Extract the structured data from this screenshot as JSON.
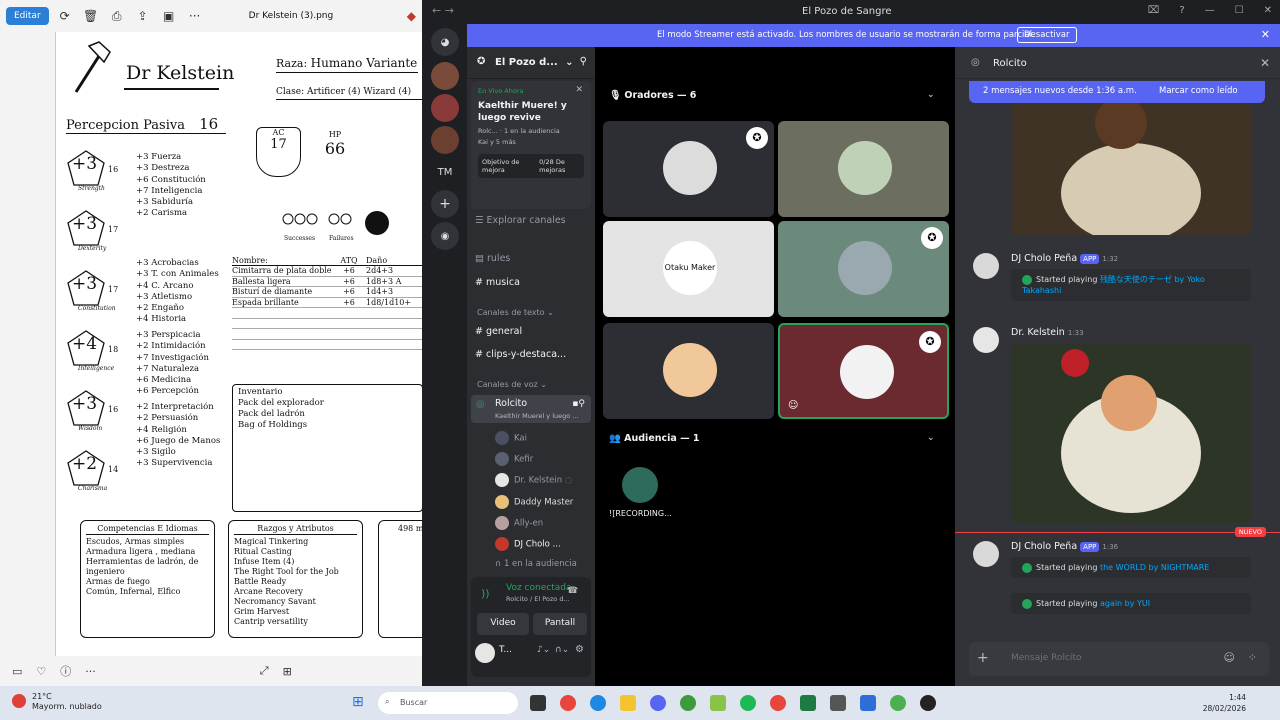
{
  "photo_viewer": {
    "edit_label": "Editar",
    "title": "Dr Kelstein (3).png"
  },
  "sheet": {
    "name": "Dr Kelstein",
    "race_label": "Raza:",
    "race": "Humano Variante",
    "class_label": "Clase:",
    "class": "Artificer (4) Wizard (4)",
    "perception_label": "Percepcion Pasiva",
    "perception": "16",
    "ac_label": "AC",
    "ac": "17",
    "hp_label": "HP",
    "hp": "66",
    "successes": "Successes",
    "failures": "Failures",
    "stats": [
      {
        "mod": "+3",
        "score": "16",
        "label": "Strength"
      },
      {
        "mod": "+3",
        "score": "17",
        "label": "Dexterity"
      },
      {
        "mod": "+3",
        "score": "17",
        "label": "Constitution"
      },
      {
        "mod": "+4",
        "score": "18",
        "label": "Intelligence"
      },
      {
        "mod": "+3",
        "score": "16",
        "label": "Wisdom"
      },
      {
        "mod": "+2",
        "score": "14",
        "label": "Charisma"
      }
    ],
    "saves": [
      "+3 Fuerza",
      "+3 Destreza",
      "+6 Constitución",
      "+7 Inteligencia",
      "+3 Sabiduría",
      "+2 Carisma"
    ],
    "skills_a": [
      "+3 Acrobacias",
      "+3 T. con Animales",
      "+4 C. Arcano",
      "+3 Atletismo",
      "+2 Engaño",
      "+4 Historia"
    ],
    "skills_b": [
      "+3 Perspicacia",
      "+2 Intimidación",
      "+7 Investigación",
      "+7 Naturaleza",
      "+6 Medicina",
      "+6 Percepción"
    ],
    "skills_c": [
      "+2 Interpretación",
      "+2 Persuasión",
      "+4 Religión",
      "+6 Juego de Manos",
      "+3 Sigilo",
      "+3 Supervivencia"
    ],
    "weapons_header": [
      "Nombre:",
      "ATQ",
      "Daño"
    ],
    "weapons": [
      [
        "Cimitarra de plata doble filo",
        "+6",
        "2d4+3"
      ],
      [
        "Ballesta ligera",
        "+6",
        "1d8+3 A"
      ],
      [
        "Bisturí de diamante",
        "+6",
        "1d4+3"
      ],
      [
        "Espada brillante",
        "+6",
        "1d8/1d10+"
      ]
    ],
    "inventory": [
      "Inventario",
      "Pack del explorador",
      "Pack del ladrón",
      "Bag of Holdings"
    ],
    "prof_title": "Competencias E Idiomas",
    "prof": [
      "Escudos, Armas simples",
      "Armadura ligera , mediana",
      "Herramientas de ladrón, de ingeniero",
      "Armas de fuego",
      "Común, Infernal, Elfico"
    ],
    "traits_title": "Razgos y Atributos",
    "traits": [
      "Magical Tinkering",
      "Ritual Casting",
      "Infuse Item (4)",
      "The Right Tool for the Job",
      "Battle Ready",
      "Arcane Recovery",
      "Necromancy Savant",
      "Grim Harvest",
      "Cantrip versatility"
    ],
    "right_box": "498 m"
  },
  "discord": {
    "window_title": "El Pozo de Sangre",
    "banner_text": "El modo Streamer está activado. Los nombres de usuario se mostrarán de forma parcial.",
    "banner_button": "Desactivar",
    "guild_tm": "TM",
    "server_name": "El Pozo d...",
    "live": {
      "status": "En Vivo Ahora",
      "title": "Kaelthir Muere! y luego revive",
      "meta1": "Rolc...  ·  1 en la audiencia",
      "meta2": "Kai y 5 más",
      "goal_label": "Objetivo de mejora",
      "goal_value": "0/28 De mejoras"
    },
    "explore": "Explorar canales",
    "channels": {
      "rules": "rules",
      "musica": "musica",
      "text_cat": "Canales de texto",
      "general": "general",
      "clips": "clips-y-destaca...",
      "voice_cat": "Canales de voz",
      "voice_channel": "Rolcito",
      "voice_sub": "Kaelthir Muerel y luego ..."
    },
    "voice_users": [
      "Kai",
      "Kefir",
      "Dr. Kelstein",
      "Daddy Master",
      "Ally-en",
      "DJ Cholo ...",
      "1 en la audiencia"
    ],
    "voice_panel": {
      "status": "Voz conectada",
      "sub": "Rolcito / El Pozo d...",
      "video": "Video",
      "screen": "Pantall",
      "user": "T..."
    },
    "stage": {
      "speakers": "Oradores — 6",
      "audience": "Audiencia — 1",
      "audience_member": "![RECORDING...",
      "tile_text": "Otaku Maker"
    },
    "chat": {
      "title": "Rolcito",
      "new_messages": "2 mensajes nuevos desde 1:36 a.m.",
      "mark_read": "Marcar como leído",
      "messages": [
        {
          "author": "DJ Cholo Peña",
          "badge": "APP",
          "time": "1:32",
          "embeds": [
            {
              "prefix": "Started playing ",
              "link": "残酷な天使のテーゼ by Yoko Takahashi"
            }
          ]
        },
        {
          "author": "Dr. Kelstein",
          "time": "1:33"
        },
        {
          "author": "DJ Cholo Peña",
          "badge": "APP",
          "time": "1:36",
          "embeds": [
            {
              "prefix": "Started playing ",
              "link": "the WORLD by NIGHTMARE"
            },
            {
              "prefix": "Started playing ",
              "link": "again by YUI"
            }
          ]
        }
      ],
      "new_marker": "NUEVO",
      "placeholder": "Mensaje Rolcito"
    }
  },
  "taskbar": {
    "temp": "21°C",
    "weather": "Mayorm. nublado",
    "search": "Buscar",
    "time": "1:44",
    "date": "28/02/2026"
  }
}
